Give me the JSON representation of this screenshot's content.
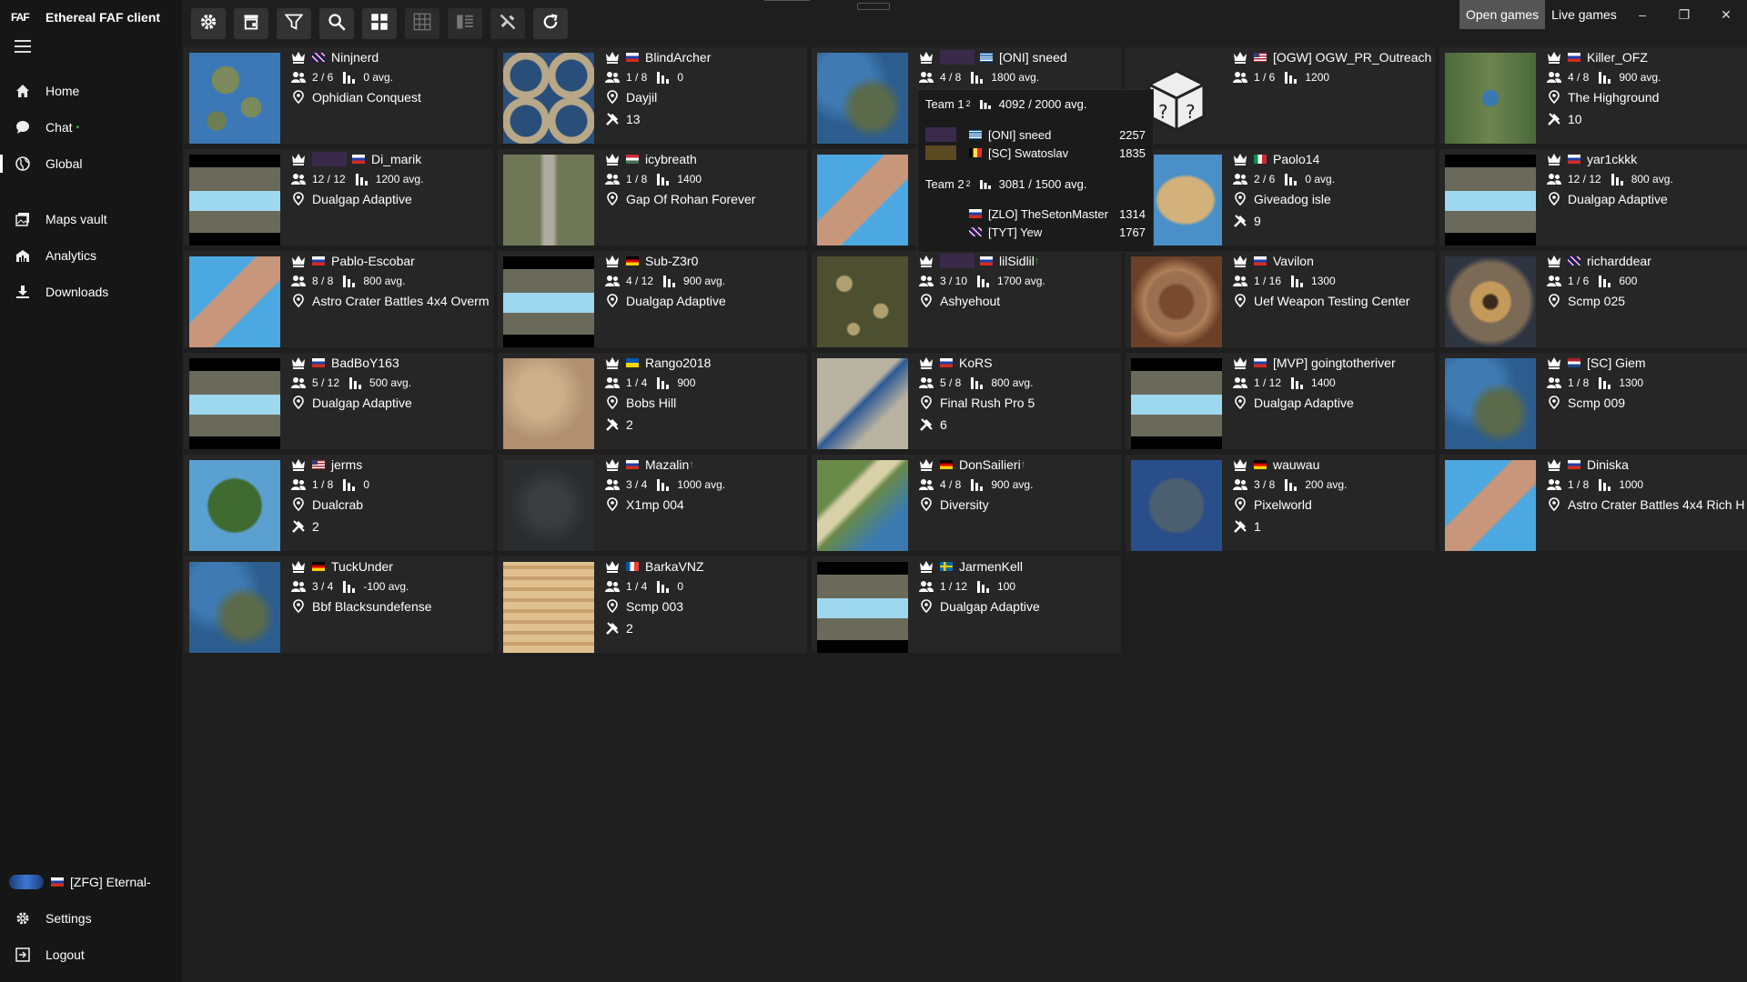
{
  "app": {
    "title": "Ethereal FAF client",
    "logo": "FAF"
  },
  "nav": [
    {
      "label": "Home",
      "icon": "home-icon"
    },
    {
      "label": "Chat",
      "icon": "chat-icon",
      "dot": "•"
    },
    {
      "label": "Global",
      "icon": "globe-icon"
    },
    {
      "label": "Maps vault",
      "icon": "maps-icon"
    },
    {
      "label": "Analytics",
      "icon": "analytics-icon"
    },
    {
      "label": "Downloads",
      "icon": "download-icon"
    }
  ],
  "user": {
    "name": "[ZFG] Eternal-",
    "flag": "ru"
  },
  "bottom_nav": [
    {
      "label": "Settings"
    },
    {
      "label": "Logout"
    }
  ],
  "toolbar": [
    "gear-icon",
    "store-icon",
    "filter-icon",
    "search-icon",
    "tiles-icon",
    "grid-icon",
    "list-icon",
    "tools-icon",
    "refresh-icon"
  ],
  "tabs": {
    "open": "Open games",
    "live": "Live games"
  },
  "window_controls": {
    "minimize": "–",
    "restore": "❐",
    "close": "✕"
  },
  "colors": {
    "card": "#262626",
    "background": "#1e1e1e",
    "sidebar": "#161616",
    "active_tab": "#555555"
  },
  "games": [
    {
      "host": "Ninjnerd",
      "flag": "gb",
      "players": "2 / 6",
      "rating": "0 avg.",
      "map": "Ophidian Conquest",
      "mods": "",
      "thumb": "islands"
    },
    {
      "host": "BlindArcher",
      "flag": "ru",
      "players": "1 / 8",
      "rating": "0",
      "map": "Dayjil",
      "mods": "13",
      "thumb": "rings"
    },
    {
      "host": "[ONI] sneed",
      "flag": "gr",
      "players": "4 / 8",
      "rating": "1800 avg.",
      "map": "",
      "mods": "",
      "thumb": "blue",
      "badge": true
    },
    {
      "host": "[OGW] OGW_PR_Outreach",
      "flag": "us",
      "players": "1 / 6",
      "rating": "1200",
      "map": "",
      "mods": "",
      "thumb": "dice"
    },
    {
      "host": "Killer_OFZ",
      "flag": "ru",
      "players": "4 / 8",
      "rating": "900 avg.",
      "map": "The Highground",
      "mods": "10",
      "thumb": "green"
    },
    {
      "host": "Di_marik",
      "flag": "ru",
      "players": "12 / 12",
      "rating": "1200 avg.",
      "map": "Dualgap Adaptive",
      "mods": "",
      "thumb": "dualgap",
      "badge": true
    },
    {
      "host": "icybreath",
      "flag": "hu",
      "players": "1 / 8",
      "rating": "1400",
      "map": "Gap Of Rohan Forever",
      "mods": "",
      "thumb": "rohan"
    },
    {
      "host": "",
      "flag": "",
      "players": "",
      "rating": "",
      "map": "",
      "mods": "",
      "thumb": "astro"
    },
    {
      "host": "Paolo14",
      "flag": "it",
      "players": "2 / 6",
      "rating": "0 avg.",
      "map": "Giveadog isle",
      "mods": "9",
      "thumb": "isle"
    },
    {
      "host": "yar1ckkk",
      "flag": "ru",
      "players": "12 / 12",
      "rating": "800 avg.",
      "map": "Dualgap Adaptive",
      "mods": "",
      "thumb": "dualgap"
    },
    {
      "host": "Pablo-Escobar",
      "flag": "ru",
      "players": "8 / 8",
      "rating": "800 avg.",
      "map": "Astro Crater Battles 4x4 Overm",
      "mods": "",
      "thumb": "astro"
    },
    {
      "host": "Sub-Z3r0",
      "flag": "de",
      "players": "4 / 12",
      "rating": "900 avg.",
      "map": "Dualgap Adaptive",
      "mods": "",
      "thumb": "dualgap"
    },
    {
      "host": "lilSidlil",
      "flag": "ru",
      "players": "3 / 10",
      "rating": "1700 avg.",
      "map": "Ashyehout",
      "mods": "",
      "thumb": "ashy",
      "badge": true,
      "up": "↑"
    },
    {
      "host": "Vavilon",
      "flag": "ru",
      "players": "1 / 16",
      "rating": "1300",
      "map": "Uef Weapon Testing Center",
      "mods": "",
      "thumb": "uef"
    },
    {
      "host": "richarddear",
      "flag": "gb",
      "players": "1 / 6",
      "rating": "600",
      "map": "Scmp 025",
      "mods": "",
      "thumb": "tri"
    },
    {
      "host": "BadBoY163",
      "flag": "ru",
      "players": "5 / 12",
      "rating": "500 avg.",
      "map": "Dualgap Adaptive",
      "mods": "",
      "thumb": "dualgap"
    },
    {
      "host": "Rango2018",
      "flag": "ua",
      "players": "1 / 4",
      "rating": "900",
      "map": "Bobs Hill",
      "mods": "2",
      "thumb": "desert"
    },
    {
      "host": "KoRS",
      "flag": "ru",
      "players": "5 / 8",
      "rating": "800 avg.",
      "map": "Final Rush Pro 5",
      "mods": "6",
      "thumb": "rush"
    },
    {
      "host": "[MVP] goingtotheriver",
      "flag": "ru",
      "players": "1 / 12",
      "rating": "1400",
      "map": "Dualgap Adaptive",
      "mods": "",
      "thumb": "dualgap"
    },
    {
      "host": "[SC] Giem",
      "flag": "nl",
      "players": "1 / 8",
      "rating": "1300",
      "map": "Scmp 009",
      "mods": "",
      "thumb": "blue"
    },
    {
      "host": "jerms",
      "flag": "us",
      "players": "1 / 8",
      "rating": "0",
      "map": "Dualcrab",
      "mods": "2",
      "thumb": "crab"
    },
    {
      "host": "Mazalin",
      "flag": "ru",
      "players": "3 / 4",
      "rating": "1000 avg.",
      "map": "X1mp 004",
      "mods": "",
      "thumb": "dark",
      "up": "↑"
    },
    {
      "host": "DonSailieri",
      "flag": "de",
      "players": "4 / 8",
      "rating": "900 avg.",
      "map": "Diversity",
      "mods": "",
      "thumb": "div",
      "up": "↑"
    },
    {
      "host": "wauwau",
      "flag": "de",
      "players": "3 / 8",
      "rating": "200 avg.",
      "map": "Pixelworld",
      "mods": "1",
      "thumb": "pixel"
    },
    {
      "host": "Diniska",
      "flag": "ru",
      "players": "1 / 8",
      "rating": "1000",
      "map": "Astro Crater Battles 4x4 Rich H",
      "mods": "",
      "thumb": "astro"
    },
    {
      "host": "TuckUnder",
      "flag": "de",
      "players": "3 / 4",
      "rating": "-100 avg.",
      "map": "Bbf Blacksundefense",
      "mods": "",
      "thumb": "blue"
    },
    {
      "host": "BarkaVNZ",
      "flag": "fr",
      "players": "1 / 4",
      "rating": "0",
      "map": "Scmp 003",
      "mods": "2",
      "thumb": "sand"
    },
    {
      "host": "JarmenKell",
      "flag": "se",
      "players": "1 / 12",
      "rating": "100",
      "map": "Dualgap Adaptive",
      "mods": "",
      "thumb": "dualgap"
    }
  ],
  "tooltip": {
    "teams": [
      {
        "label": "Team 1",
        "sup": "2",
        "rating": "4092 / 2000 avg.",
        "players": [
          {
            "name": "[ONI] sneed",
            "flag": "gr",
            "rating": "2257",
            "badge": "oni"
          },
          {
            "name": "[SC] Swatoslav",
            "flag": "be",
            "rating": "1835",
            "badge": "sc"
          }
        ]
      },
      {
        "label": "Team 2",
        "sup": "2",
        "rating": "3081 / 1500 avg.",
        "players": [
          {
            "name": "[ZLO] TheSetonMaster",
            "flag": "ru",
            "rating": "1314"
          },
          {
            "name": "[TYT] Yew",
            "flag": "gb",
            "rating": "1767"
          }
        ]
      }
    ]
  }
}
